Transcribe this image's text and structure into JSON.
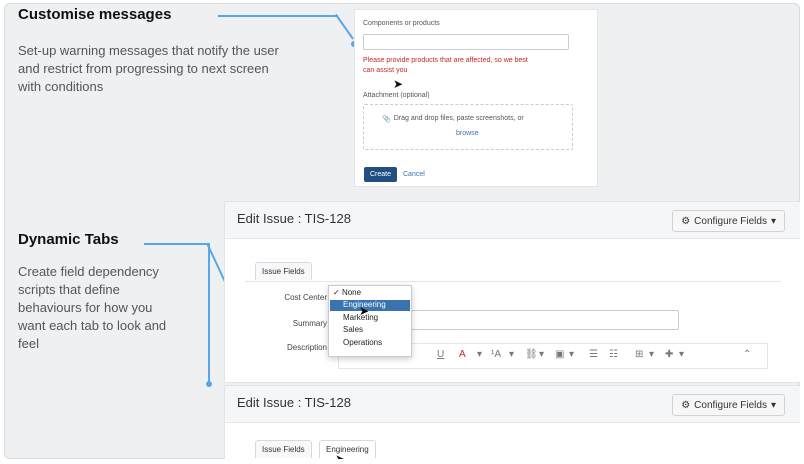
{
  "colors": {
    "accent": "#5aa6e6",
    "error": "#c62828",
    "primary_button": "#205081",
    "dropdown_highlight": "#3b73af"
  },
  "annotations": {
    "customise": {
      "title": "Customise messages",
      "text_lines": [
        "Set-up warning messages that notify the user",
        "and restrict from progressing to next screen",
        "with conditions"
      ]
    },
    "dynamic": {
      "title": "Dynamic Tabs",
      "text_lines": [
        "Create field dependency",
        "scripts that define",
        "behaviours for how you",
        "want each tab to look and",
        "feel"
      ]
    }
  },
  "top_form": {
    "components_label": "Components or products",
    "components_value": "",
    "error_text_lines": [
      "Please provide products that are affected, so we best",
      "can assist you"
    ],
    "attachment_label": "Attachment (optional)",
    "dropzone_text": "Drag and drop files, paste screenshots, or",
    "browse_link": "browse",
    "create_button": "Create",
    "cancel_link": "Cancel"
  },
  "edit_issue_1": {
    "title": "Edit Issue : TIS-128",
    "configure_fields": "Configure Fields",
    "tab_issue_fields": "Issue Fields",
    "labels": {
      "cost_center": "Cost Center",
      "summary": "Summary",
      "description": "Description"
    },
    "dropdown": {
      "options": [
        "None",
        "Engineering",
        "Marketing",
        "Sales",
        "Operations"
      ],
      "checked": "None",
      "highlighted": "Engineering"
    },
    "toolbar_icons": [
      "style",
      "bold",
      "italic",
      "underline",
      "text-color",
      "font-size",
      "link",
      "image",
      "table",
      "bullet-list",
      "numbered-list",
      "more",
      "add",
      "collapse"
    ]
  },
  "edit_issue_2": {
    "title": "Edit Issue : TIS-128",
    "configure_fields": "Configure Fields",
    "tabs": [
      "Issue Fields",
      "Engineering"
    ]
  },
  "icons": {
    "gear": "gear-icon",
    "caret": "caret-down-icon",
    "checkmark": "checkmark-icon",
    "paperclip": "paperclip-icon",
    "cursor": "mouse-pointer-icon"
  }
}
